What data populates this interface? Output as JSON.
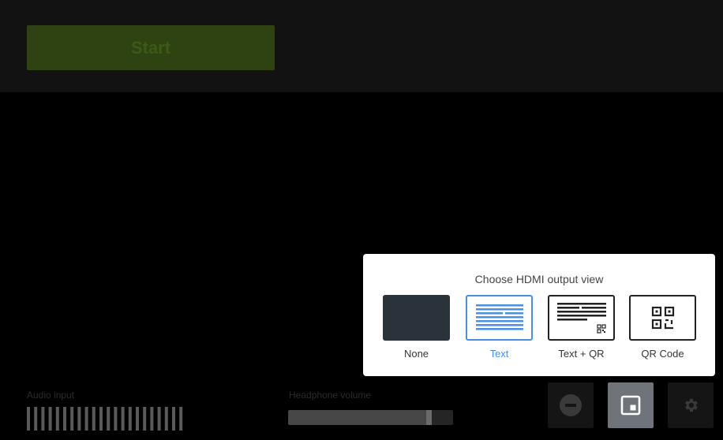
{
  "toolbar": {
    "start_label": "Start"
  },
  "hdmi_panel": {
    "title": "Choose HDMI output view",
    "options": [
      {
        "label": "None",
        "icon": "blank-screen-icon",
        "selected": false
      },
      {
        "label": "Text",
        "icon": "text-lines-icon",
        "selected": true
      },
      {
        "label": "Text + QR",
        "icon": "text-qr-icon",
        "selected": false
      },
      {
        "label": "QR Code",
        "icon": "qr-code-icon",
        "selected": false
      }
    ]
  },
  "audio": {
    "label": "Audio input"
  },
  "headphones": {
    "label": "Headphone volume",
    "level_percent": 87
  },
  "controls": [
    {
      "icon": "minus-circle-icon"
    },
    {
      "icon": "hdmi-output-icon"
    },
    {
      "icon": "gear-icon"
    }
  ],
  "colors": {
    "accent": "#4a90e2",
    "start_button": "#2e4212",
    "panel_bg": "#ffffff",
    "page_bg": "#000000"
  }
}
